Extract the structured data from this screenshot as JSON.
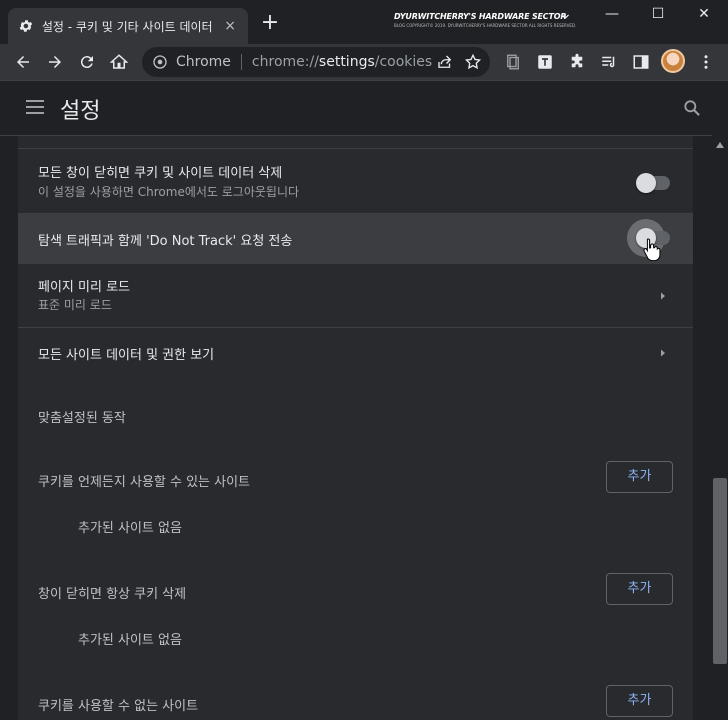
{
  "tab": {
    "title": "설정 - 쿠키 및 기타 사이트 데이터",
    "close": "×",
    "new_tab": "+"
  },
  "watermark": {
    "title": "DYURWITCHERRY'S HARDWARE SECTOR",
    "subtitle": "BLOG COPYRIGHT© 2019. DYURWITCHERRY'S HARDWARE SECTOR ALL RIGHTS RESERVED."
  },
  "window": {
    "minimize": "—",
    "maximize": "☐",
    "close": "✕",
    "dropdown": "⌄"
  },
  "omnibox": {
    "chip": "Chrome",
    "url_prefix": "chrome://",
    "url_main": "settings",
    "url_suffix": "/cookies"
  },
  "header": {
    "title": "설정"
  },
  "rows": [
    {
      "title": "모든 창이 닫히면 쿠키 및 사이트 데이터 삭제",
      "subtitle": "이 설정을 사용하면 Chrome에서도 로그아웃됩니다",
      "toggle": "off"
    },
    {
      "title": "탐색 트래픽과 함께 'Do Not Track' 요청 전송",
      "toggle": "off",
      "hovered": true
    },
    {
      "title": "페이지 미리 로드",
      "subtitle": "표준 미리 로드"
    },
    {
      "title": "모든 사이트 데이터 및 권한 보기"
    }
  ],
  "custom": {
    "heading": "맞춤설정된 동작",
    "sections": [
      {
        "label": "쿠키를 언제든지 사용할 수 있는 사이트",
        "button": "추가",
        "empty": "추가된 사이트 없음"
      },
      {
        "label": "창이 닫히면 항상 쿠키 삭제",
        "button": "추가",
        "empty": "추가된 사이트 없음"
      },
      {
        "label": "쿠키를 사용할 수 없는 사이트",
        "button": "추가"
      }
    ]
  },
  "colors": {
    "accent": "#8ab4f8",
    "background": "#202124",
    "card": "#292a2d"
  }
}
